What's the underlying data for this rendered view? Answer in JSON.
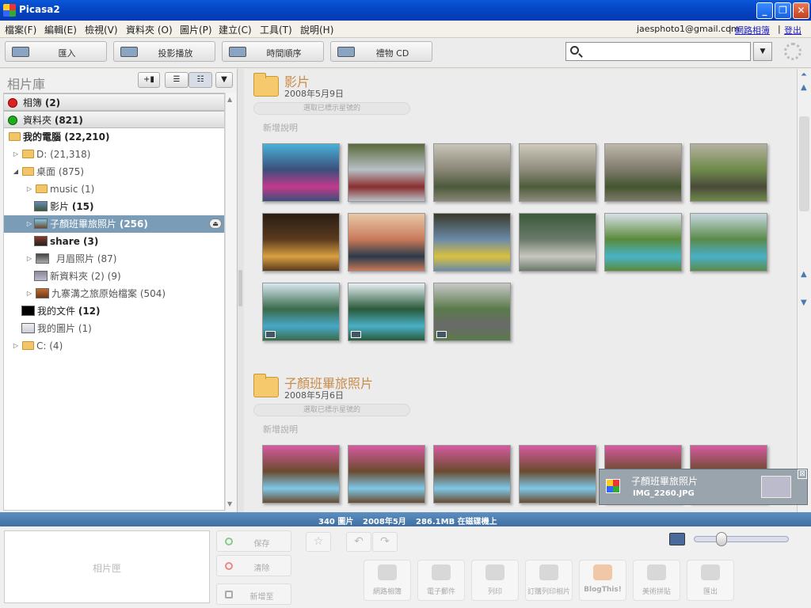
{
  "window": {
    "title": "Picasa2",
    "min": "_",
    "max": "❐",
    "close": "✕"
  },
  "menu": {
    "items": [
      "檔案(F)",
      "編輯(E)",
      "檢視(V)",
      "資料夾 (O)",
      "圖片(P)",
      "建立(C)",
      "工具(T)",
      "說明(H)"
    ],
    "account": "jaesphoto1@gmail.com",
    "sep1": "|",
    "web_albums": "網路相簿",
    "sep2": "|",
    "logout": "登出"
  },
  "toolbar": {
    "import": "匯入",
    "slideshow": "投影播放",
    "timeline": "時間順序",
    "gift_cd": "禮物 CD",
    "search_value": "",
    "search_drop": "▼"
  },
  "library": {
    "title": "相片庫",
    "btn_add": "+▮",
    "btn_list1": "☰",
    "btn_list2": "☷",
    "btn_menu": "▼",
    "albums": {
      "label": "相簿",
      "count": "(2)"
    },
    "folders": {
      "label": "資料夾",
      "count": "(821)"
    },
    "tree": [
      {
        "label": "我的電腦",
        "count": "(22,210)",
        "bold": true
      },
      {
        "label": "D:",
        "count": "(21,318)",
        "bold": false
      },
      {
        "label": "桌面",
        "count": "(875)",
        "bold": false
      },
      {
        "label": "music",
        "count": "(1)",
        "bold": false
      },
      {
        "label": "影片",
        "count": "(15)",
        "bold": true
      },
      {
        "label": "子顏班畢旅照片",
        "count": "(256)",
        "bold": true
      },
      {
        "label": "share",
        "count": "(3)",
        "bold": true
      },
      {
        "label": "月眉照片",
        "count": "(87)",
        "bold": false
      },
      {
        "label": "新資料夾",
        "count": "(2) (9)",
        "bold": false
      },
      {
        "label": "九寨溝之旅原始檔案",
        "count": "(504)",
        "bold": false
      },
      {
        "label": "我的文件",
        "count": "(12)",
        "bold": true
      },
      {
        "label": "我的圖片",
        "count": "(1)",
        "bold": false
      },
      {
        "label": "C:",
        "count": "(4)",
        "bold": false
      }
    ],
    "eject": "⏏"
  },
  "groups": [
    {
      "title": "影片",
      "date": "2008年5月9日",
      "star_label": "選取已標示星號的",
      "add_desc": "新增說明",
      "photos": [
        {
          "colors": [
            "#3a4f7a",
            "#c23a8c",
            "#4ab0d8"
          ],
          "movie": false
        },
        {
          "colors": [
            "#b8c0c6",
            "#8a2e2e",
            "#5a6a3a"
          ],
          "movie": false
        },
        {
          "colors": [
            "#8a8676",
            "#4a5a3a",
            "#c8c4b8"
          ],
          "movie": false
        },
        {
          "colors": [
            "#8f8b7c",
            "#4d5c3a",
            "#cfcabc"
          ],
          "movie": false
        },
        {
          "colors": [
            "#7e7a6b",
            "#43552f",
            "#bdb8aa"
          ],
          "movie": false
        },
        {
          "colors": [
            "#6f8a4a",
            "#4a4a3a",
            "#b4b0a0"
          ],
          "movie": false
        },
        {
          "colors": [
            "#5a3a1e",
            "#d8a040",
            "#2a1e14"
          ],
          "movie": false
        },
        {
          "colors": [
            "#c87a5a",
            "#2a3a4a",
            "#e8c8a8"
          ],
          "movie": false
        },
        {
          "colors": [
            "#6a8aa8",
            "#d8c040",
            "#3a3a2a"
          ],
          "movie": false
        },
        {
          "colors": [
            "#6a7a6a",
            "#c8c8c0",
            "#3a5a3a"
          ],
          "movie": false
        },
        {
          "colors": [
            "#5a8a3a",
            "#48b4c8",
            "#d8e0e8"
          ],
          "movie": false
        },
        {
          "colors": [
            "#5a8a4a",
            "#4ab0c8",
            "#c8d8e0"
          ],
          "movie": false
        },
        {
          "colors": [
            "#3a6a4a",
            "#48a8c8",
            "#d8e8f0"
          ],
          "movie": true
        },
        {
          "colors": [
            "#2a5a3a",
            "#4ab0c8",
            "#e8f0f4"
          ],
          "movie": true
        },
        {
          "colors": [
            "#5a7a4a",
            "#6a6a6a",
            "#c8c8c8"
          ],
          "movie": true
        }
      ]
    },
    {
      "title": "子顏班畢旅照片",
      "date": "2008年5月6日",
      "star_label": "選取已標示星號的",
      "add_desc": "新增說明",
      "photos": [
        {
          "colors": [
            "#6a4a2e",
            "#7ec8e8",
            "#d85aa0"
          ],
          "movie": false
        },
        {
          "colors": [
            "#6a4a2e",
            "#7ec8e8",
            "#d85aa0"
          ],
          "movie": false
        },
        {
          "colors": [
            "#6a4a2e",
            "#7ec8e8",
            "#d85aa0"
          ],
          "movie": false
        },
        {
          "colors": [
            "#6a4a2e",
            "#7ec8e8",
            "#d85aa0"
          ],
          "movie": false
        },
        {
          "colors": [
            "#6a4a2e",
            "#7ec8e8",
            "#d85aa0"
          ],
          "movie": false
        },
        {
          "colors": [
            "#6a4a2e",
            "#7ec8e8",
            "#d85aa0"
          ],
          "movie": false
        }
      ]
    }
  ],
  "notify": {
    "title": "子顏班畢旅照片",
    "file": "IMG_2260.JPG",
    "close": "⊠"
  },
  "status": {
    "count": "340 圖片",
    "date": "2008年5月",
    "size": "286.1MB 在磁碟機上"
  },
  "bottom": {
    "tray_label": "相片匣",
    "save": "保存",
    "clear": "清除",
    "add_to": "新增至",
    "star": "☆",
    "rotate_left": "↶",
    "rotate_right": "↷",
    "actions": [
      "網路相簿",
      "電子郵件",
      "列印",
      "訂購列印相片",
      "BlogThis!",
      "美術拼貼",
      "匯出"
    ],
    "zoom_level": 0.25
  }
}
